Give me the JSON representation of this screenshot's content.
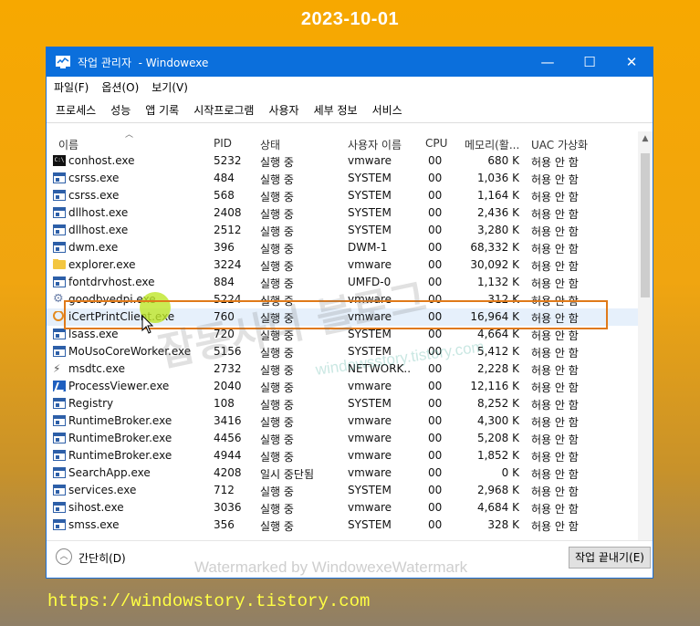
{
  "banner": {
    "date": "2023-10-01",
    "url": "https://windowstory.tistory.com"
  },
  "window": {
    "title": "작업 관리자  - Windowexe",
    "controls": {
      "minimize": "—",
      "maximize": "☐",
      "close": "✕"
    }
  },
  "menu": [
    "파일(F)",
    "옵션(O)",
    "보기(V)"
  ],
  "tabs": [
    "프로세스",
    "성능",
    "앱 기록",
    "시작프로그램",
    "사용자",
    "세부 정보",
    "서비스"
  ],
  "active_tab": "세부 정보",
  "columns": {
    "name": "이름",
    "pid": "PID",
    "status": "상태",
    "user": "사용자 이름",
    "cpu": "CPU",
    "memory": "메모리(활...",
    "uac": "UAC 가상화"
  },
  "rows": [
    {
      "icon": "cmd-icon",
      "name": "conhost.exe",
      "pid": "5232",
      "status": "실행 중",
      "user": "vmware",
      "cpu": "00",
      "memory": "680 K",
      "uac": "허용 안 함"
    },
    {
      "icon": "exe-icon",
      "name": "csrss.exe",
      "pid": "484",
      "status": "실행 중",
      "user": "SYSTEM",
      "cpu": "00",
      "memory": "1,036 K",
      "uac": "허용 안 함"
    },
    {
      "icon": "exe-icon",
      "name": "csrss.exe",
      "pid": "568",
      "status": "실행 중",
      "user": "SYSTEM",
      "cpu": "00",
      "memory": "1,164 K",
      "uac": "허용 안 함"
    },
    {
      "icon": "exe-icon",
      "name": "dllhost.exe",
      "pid": "2408",
      "status": "실행 중",
      "user": "SYSTEM",
      "cpu": "00",
      "memory": "2,436 K",
      "uac": "허용 안 함"
    },
    {
      "icon": "exe-icon",
      "name": "dllhost.exe",
      "pid": "2512",
      "status": "실행 중",
      "user": "SYSTEM",
      "cpu": "00",
      "memory": "3,280 K",
      "uac": "허용 안 함"
    },
    {
      "icon": "exe-icon",
      "name": "dwm.exe",
      "pid": "396",
      "status": "실행 중",
      "user": "DWM-1",
      "cpu": "00",
      "memory": "68,332 K",
      "uac": "허용 안 함"
    },
    {
      "icon": "folder-icon",
      "name": "explorer.exe",
      "pid": "3224",
      "status": "실행 중",
      "user": "vmware",
      "cpu": "00",
      "memory": "30,092 K",
      "uac": "허용 안 함"
    },
    {
      "icon": "exe-icon",
      "name": "fontdrvhost.exe",
      "pid": "884",
      "status": "실행 중",
      "user": "UMFD-0",
      "cpu": "00",
      "memory": "1,132 K",
      "uac": "허용 안 함"
    },
    {
      "icon": "gear-icon",
      "name": "goodbyedpi.exe",
      "pid": "5224",
      "status": "실행 중",
      "user": "vmware",
      "cpu": "00",
      "memory": "312 K",
      "uac": "허용 안 함"
    },
    {
      "icon": "circle-icon",
      "name": "iCertPrintClient.exe",
      "pid": "760",
      "status": "실행 중",
      "user": "vmware",
      "cpu": "00",
      "memory": "16,964 K",
      "uac": "허용 안 함",
      "selected": true
    },
    {
      "icon": "exe-icon",
      "name": "lsass.exe",
      "pid": "720",
      "status": "실행 중",
      "user": "SYSTEM",
      "cpu": "00",
      "memory": "4,664 K",
      "uac": "허용 안 함"
    },
    {
      "icon": "exe-icon",
      "name": "MoUsoCoreWorker.exe",
      "pid": "5156",
      "status": "실행 중",
      "user": "SYSTEM",
      "cpu": "00",
      "memory": "5,412 K",
      "uac": "허용 안 함"
    },
    {
      "icon": "msdtc-icon",
      "name": "msdtc.exe",
      "pid": "2732",
      "status": "실행 중",
      "user": "NETWORK...",
      "cpu": "00",
      "memory": "2,228 K",
      "uac": "허용 안 함"
    },
    {
      "icon": "pv-icon",
      "name": "ProcessViewer.exe",
      "pid": "2040",
      "status": "실행 중",
      "user": "vmware",
      "cpu": "00",
      "memory": "12,116 K",
      "uac": "허용 안 함"
    },
    {
      "icon": "exe-icon",
      "name": "Registry",
      "pid": "108",
      "status": "실행 중",
      "user": "SYSTEM",
      "cpu": "00",
      "memory": "8,252 K",
      "uac": "허용 안 함"
    },
    {
      "icon": "exe-icon",
      "name": "RuntimeBroker.exe",
      "pid": "3416",
      "status": "실행 중",
      "user": "vmware",
      "cpu": "00",
      "memory": "4,300 K",
      "uac": "허용 안 함"
    },
    {
      "icon": "exe-icon",
      "name": "RuntimeBroker.exe",
      "pid": "4456",
      "status": "실행 중",
      "user": "vmware",
      "cpu": "00",
      "memory": "5,208 K",
      "uac": "허용 안 함"
    },
    {
      "icon": "exe-icon",
      "name": "RuntimeBroker.exe",
      "pid": "4944",
      "status": "실행 중",
      "user": "vmware",
      "cpu": "00",
      "memory": "1,852 K",
      "uac": "허용 안 함"
    },
    {
      "icon": "exe-icon",
      "name": "SearchApp.exe",
      "pid": "4208",
      "status": "일시 중단됨",
      "user": "vmware",
      "cpu": "00",
      "memory": "0 K",
      "uac": "허용 안 함"
    },
    {
      "icon": "exe-icon",
      "name": "services.exe",
      "pid": "712",
      "status": "실행 중",
      "user": "SYSTEM",
      "cpu": "00",
      "memory": "2,968 K",
      "uac": "허용 안 함"
    },
    {
      "icon": "exe-icon",
      "name": "sihost.exe",
      "pid": "3036",
      "status": "실행 중",
      "user": "vmware",
      "cpu": "00",
      "memory": "4,684 K",
      "uac": "허용 안 함"
    },
    {
      "icon": "exe-icon",
      "name": "smss.exe",
      "pid": "356",
      "status": "실행 중",
      "user": "SYSTEM",
      "cpu": "00",
      "memory": "328 K",
      "uac": "허용 안 함"
    }
  ],
  "footer": {
    "collapse_label": "간단히(D)",
    "end_task_label": "작업 끝내기(E)"
  },
  "watermarks": {
    "big": "잡동사니 블로그",
    "small": "windowsstory.tistory.com",
    "footer": "Watermarked by WindowexeWatermark"
  },
  "colors": {
    "titlebar": "#0b6fdc",
    "highlight_box": "#e07a1a",
    "url_text": "#ffff44"
  }
}
